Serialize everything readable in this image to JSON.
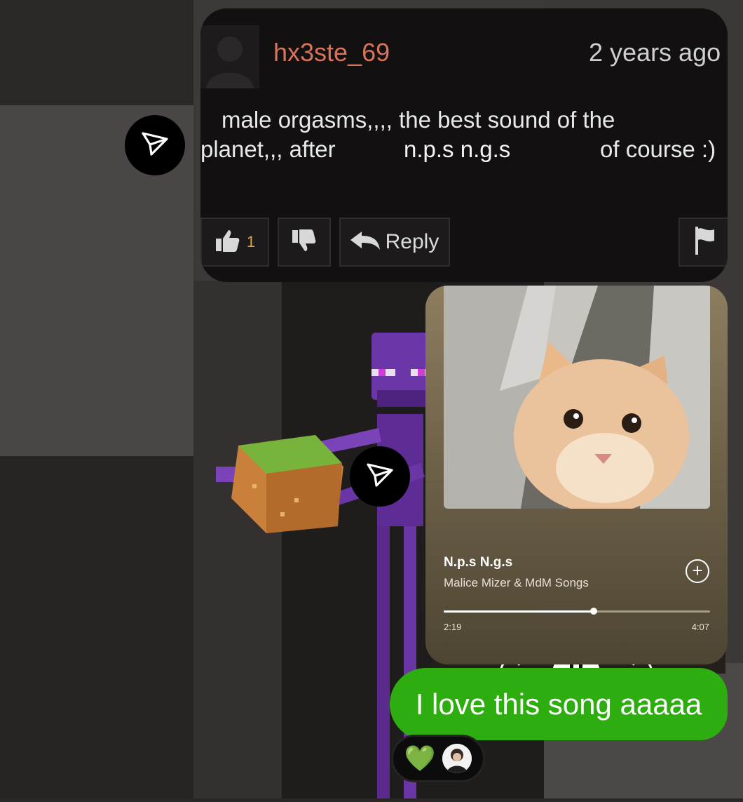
{
  "comment": {
    "username": "hx3ste_69",
    "timestamp": "2 years ago",
    "line1": "male orgasms,,,, the best sound of the",
    "line2_start": "planet,,, after",
    "line2_middle": "n.p.s n.g.s",
    "line2_end": "of course :)",
    "like_count": "1",
    "reply_label": "Reply"
  },
  "music": {
    "title": "N.p.s N.g.s",
    "artist": "Malice Mizer & MdM Songs",
    "elapsed": "2:19",
    "total": "4:07",
    "progress": 0.562
  },
  "message": {
    "text": "I love this song aaaaa"
  },
  "reactions": {
    "emoji": "💚"
  },
  "icons": {
    "send": "paper-plane-icon",
    "like": "thumbs-up-icon",
    "dislike": "thumbs-down-icon",
    "reply": "reply-arrow-icon",
    "flag": "flag-icon",
    "add": "plus-circle-icon"
  },
  "colors": {
    "username": "#d9735a",
    "bubble": "#2ead11",
    "card_bg": "#121010"
  }
}
